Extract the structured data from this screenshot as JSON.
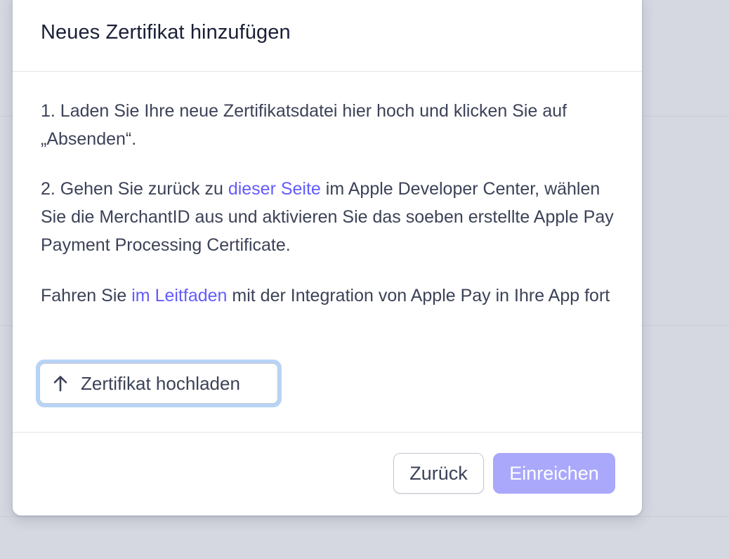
{
  "modal": {
    "title": "Neues Zertifikat hinzufügen"
  },
  "body": {
    "step1": "1. Laden Sie Ihre neue Zertifikatsdatei hier hoch und klicken Sie auf „Absenden“.",
    "step2_before": "2. Gehen Sie zurück zu ",
    "step2_link": "dieser Seite",
    "step2_after": " im Apple Developer Center, wählen Sie die MerchantID aus und aktivieren Sie das soeben erstellte Apple Pay Payment Processing Certificate.",
    "guide_before": "Fahren Sie ",
    "guide_link": "im Leitfaden",
    "guide_after": " mit der Integration von Apple Pay in Ihre App fort"
  },
  "upload": {
    "label": "Zertifikat hochladen",
    "icon": "arrow-up-icon"
  },
  "footer": {
    "back_label": "Zurück",
    "submit_label": "Einreichen"
  },
  "colors": {
    "link": "#635bff",
    "submit_disabled": "#aaa8fb",
    "focus_ring": "#b7d4f6",
    "overlay": "#d5d8e0"
  }
}
